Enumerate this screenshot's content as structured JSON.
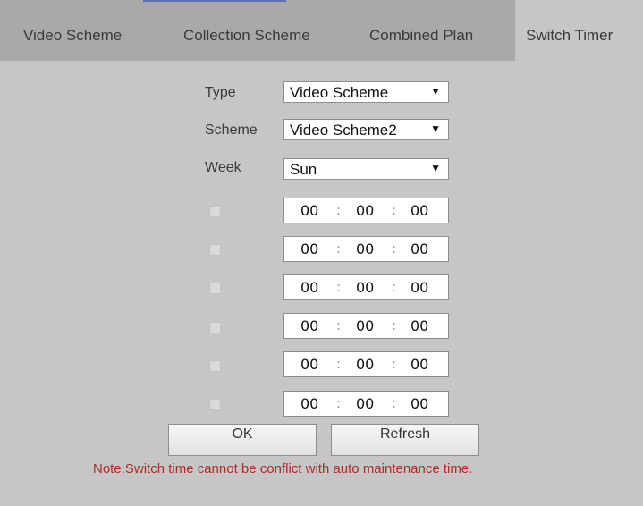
{
  "tabs": [
    {
      "label": "Video Scheme"
    },
    {
      "label": "Collection Scheme"
    },
    {
      "label": "Combined Plan"
    },
    {
      "label": "Switch Timer"
    }
  ],
  "form": {
    "type_label": "Type",
    "type_value": "Video Scheme",
    "scheme_label": "Scheme",
    "scheme_value": "Video Scheme2",
    "week_label": "Week",
    "week_value": "Sun",
    "dropdown_arrow": "▼"
  },
  "time_rows": [
    {
      "checked": false,
      "hh": "00",
      "mm": "00",
      "ss": "00"
    },
    {
      "checked": false,
      "hh": "00",
      "mm": "00",
      "ss": "00"
    },
    {
      "checked": false,
      "hh": "00",
      "mm": "00",
      "ss": "00"
    },
    {
      "checked": false,
      "hh": "00",
      "mm": "00",
      "ss": "00"
    },
    {
      "checked": false,
      "hh": "00",
      "mm": "00",
      "ss": "00"
    },
    {
      "checked": false,
      "hh": "00",
      "mm": "00",
      "ss": "00"
    }
  ],
  "time_separator": ":",
  "buttons": {
    "ok": "OK",
    "refresh": "Refresh"
  },
  "note": "Note:Switch time cannot be conflict with auto maintenance time.",
  "colors": {
    "background": "#c6c6c6",
    "tabbar": "#a9a9a9",
    "note": "#b02a2a"
  }
}
